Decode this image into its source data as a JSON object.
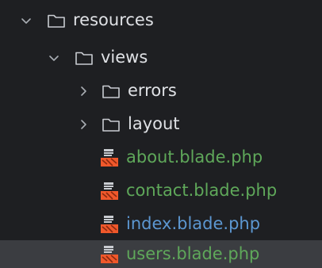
{
  "tree": {
    "resources": {
      "label": "resources",
      "icon": "folder-icon",
      "state": "expanded"
    },
    "views": {
      "label": "views",
      "icon": "folder-icon",
      "state": "expanded"
    },
    "errors": {
      "label": "errors",
      "icon": "folder-icon",
      "state": "collapsed"
    },
    "layout": {
      "label": "layout",
      "icon": "folder-icon",
      "state": "collapsed"
    },
    "files": [
      {
        "label": "about.blade.php",
        "icon": "blade-file-icon",
        "vcs_status": "added",
        "color": "#5fa85a"
      },
      {
        "label": "contact.blade.php",
        "icon": "blade-file-icon",
        "vcs_status": "added",
        "color": "#5fa85a"
      },
      {
        "label": "index.blade.php",
        "icon": "blade-file-icon",
        "vcs_status": "modified",
        "color": "#5c97d1"
      },
      {
        "label": "users.blade.php",
        "icon": "blade-file-icon",
        "vcs_status": "added",
        "color": "#5fa85a",
        "selected": true
      }
    ]
  },
  "colors": {
    "background": "#1e1f22",
    "selected_row": "#3b3d41",
    "text": "#dfe1e5",
    "added": "#5fa85a",
    "modified": "#5c97d1",
    "blade_icon_orange": "#f0582b"
  }
}
